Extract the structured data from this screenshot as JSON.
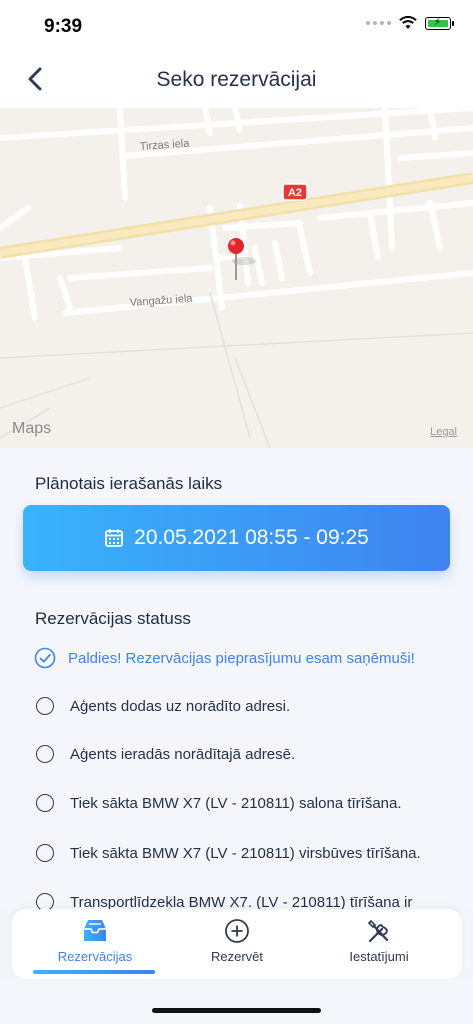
{
  "status_bar": {
    "time": "9:39"
  },
  "header": {
    "title": "Seko rezervācijai"
  },
  "map": {
    "streets": {
      "tirzas": "Tirzas iela",
      "vangazu": "Vangažu iela",
      "highway_badge": "A2"
    },
    "logo": "Maps",
    "legal": "Legal"
  },
  "arrival": {
    "label": "Plānotais ierašanās laiks",
    "value": "20.05.2021 08:55 - 09:25"
  },
  "status": {
    "label": "Rezervācijas statuss",
    "items": [
      {
        "text": "Paldies! Rezervācijas pieprasījumu esam saņēmuši!",
        "done": true
      },
      {
        "text": "Aģents dodas uz norādīto adresi.",
        "done": false
      },
      {
        "text": "Aģents ieradās norādītajā adresē.",
        "done": false
      },
      {
        "text": "Tiek sākta BMW X7 (LV - 210811) salona tīrīšana.",
        "done": false
      },
      {
        "text": "Tiek sākta BMW X7 (LV - 210811) virsbūves tīrīšana.",
        "done": false
      },
      {
        "text": "Transportlīdzekla BMW X7. (LV - 210811) tīrīšana ir",
        "done": false
      }
    ]
  },
  "tabs": [
    {
      "label": "Rezervācijas",
      "icon": "inbox-icon",
      "active": true
    },
    {
      "label": "Rezervēt",
      "icon": "plus-circle-icon",
      "active": false
    },
    {
      "label": "Iestatījumi",
      "icon": "tools-icon",
      "active": false
    }
  ],
  "colors": {
    "accent": "#3f83ef",
    "accent_light": "#39b3fb",
    "text": "#1f2a44"
  }
}
